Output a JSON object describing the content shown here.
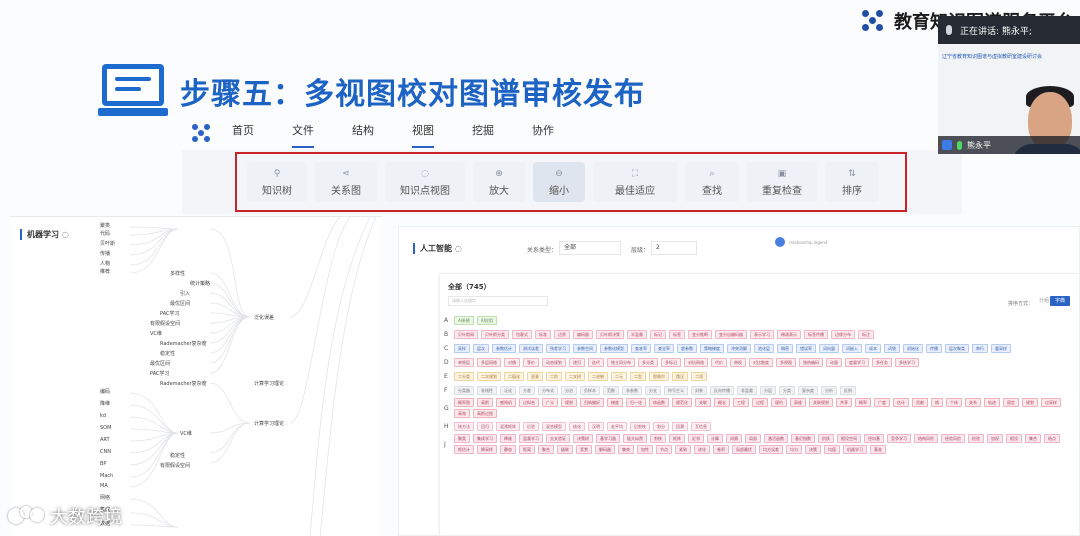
{
  "brand": {
    "text": "教育知识图谱服务平台"
  },
  "heading": {
    "title": "步骤五：多视图校对图谱审核发布"
  },
  "appnav": {
    "items": [
      {
        "label": "首页",
        "active": false
      },
      {
        "label": "文件",
        "active": true
      },
      {
        "label": "结构",
        "active": false
      },
      {
        "label": "视图",
        "active": true
      },
      {
        "label": "挖掘",
        "active": false
      },
      {
        "label": "协作",
        "active": false
      }
    ]
  },
  "toolbar": {
    "tools": [
      {
        "label": "知识树",
        "icon": "tree-icon",
        "glyph": "⚲",
        "selected": false
      },
      {
        "label": "关系图",
        "icon": "share-icon",
        "glyph": "⋖",
        "selected": false
      },
      {
        "label": "知识点视图",
        "icon": "bulb-icon",
        "glyph": "◌",
        "selected": false
      },
      {
        "label": "放大",
        "icon": "zoom-in-icon",
        "glyph": "⊕",
        "selected": false
      },
      {
        "label": "缩小",
        "icon": "zoom-out-icon",
        "glyph": "⊖",
        "selected": true
      },
      {
        "label": "最佳适应",
        "icon": "fit-icon",
        "glyph": "⛶",
        "selected": false
      },
      {
        "label": "查找",
        "icon": "search-icon",
        "glyph": "⌕",
        "selected": false
      },
      {
        "label": "重复检查",
        "icon": "check-icon",
        "glyph": "▣",
        "selected": false
      },
      {
        "label": "排序",
        "icon": "sort-icon",
        "glyph": "⇅",
        "selected": false
      }
    ]
  },
  "left_panel": {
    "title": "机器学习 ◌",
    "nodes": [
      "聚类",
      "代码",
      "贝叶斯",
      "传播",
      "人物",
      "推荐",
      "多样性",
      "统计策略",
      "引入",
      "最优区间",
      "PAC学习",
      "有限假设空间",
      "VC维",
      "Rademacher复杂度",
      "稳定性",
      "最优区间",
      "PAC学习",
      "Rademacher复杂度",
      "泛化误差",
      "计算学习理论",
      "编码",
      "降维",
      "kd",
      "SOM",
      "ART",
      "CNN",
      "BP",
      "Mach",
      "MA",
      "网络",
      "VC维",
      "计算学习理论",
      "稳定性",
      "有限假设空间",
      "集成",
      "数据"
    ]
  },
  "right_panel": {
    "title": "人工智能 ◌",
    "filter_label": "关系类型：",
    "filter_value": "全部",
    "level_label": "层级：",
    "level_value": "2",
    "dot_label": "relationship legend",
    "inner": {
      "title": "全部（745）",
      "search_placeholder": "请输入关键字",
      "sort_label": "排序方式：",
      "sort_off": "分组",
      "sort_on": "字典"
    },
    "rows": [
      {
        "letter": "A",
        "chips": [
          "AI系统",
          "AI应用"
        ]
      },
      {
        "letter": "B",
        "chips": [
          "贝叶斯网",
          "贝叶斯分类",
          "包裹式",
          "标准",
          "边界",
          "编码器",
          "贝叶斯决策",
          "半监督",
          "标记",
          "标签",
          "变分推断",
          "变分自编码器",
          "表示学习",
          "稀疏表示",
          "标签传播",
          "边缘分布",
          "标注"
        ]
      },
      {
        "letter": "C",
        "chips": [
          "采样",
          "层次",
          "参数估计",
          "测试误差",
          "残差学习",
          "参数空间",
          "参数化模型",
          "查准率",
          "查全率",
          "超参数",
          "策略梯度",
          "冲突消解",
          "池化层",
          "稠密",
          "错误率",
          "词向量",
          "词嵌入",
          "成本",
          "词袋",
          "初始化",
          "传播",
          "层次聚类",
          "串行",
          "重采样"
        ]
      },
      {
        "letter": "D",
        "chips": [
          "单隐层",
          "多层网络",
          "对偶",
          "等价",
          "动态规划",
          "递归",
          "迭代",
          "独立同分布",
          "多分类",
          "多标记",
          "对抗网络",
          "代价",
          "带权",
          "对比散度",
          "多视图",
          "独热编码",
          "动量",
          "度量学习",
          "多任务",
          "多核学习"
        ]
      },
      {
        "letter": "E",
        "chips": [
          "二分类",
          "二次规划",
          "二值化",
          "恶意",
          "二阶",
          "二叉树",
          "二进制",
          "二元",
          "二型",
          "恩格尔",
          "饿汉",
          "二项"
        ]
      },
      {
        "letter": "F",
        "chips": [
          "分类器",
          "非线性",
          "泛化",
          "方差",
          "分布式",
          "分治",
          "负样本",
          "范数",
          "非参数",
          "分支",
          "符号主义",
          "封装",
          "反向传播",
          "非监督",
          "分层",
          "分类",
          "复杂度",
          "分析",
          "反例"
        ]
      },
      {
        "letter": "G",
        "chips": [
          "概率图",
          "高斯",
          "感知机",
          "过拟合",
          "广义",
          "规则",
          "归纳偏好",
          "梯度",
          "归一化",
          "核函数",
          "规范化",
          "关联",
          "概念",
          "工程",
          "过程",
          "规约",
          "高维",
          "关联规则",
          "共享",
          "概率",
          "广度",
          "估计",
          "贡献",
          "格",
          "个体",
          "关系",
          "轨迹",
          "固定",
          "规划",
          "过采样",
          "高效",
          "高斯过程"
        ]
      },
      {
        "letter": "H",
        "chips": [
          "核方法",
          "回归",
          "混淆矩阵",
          "后验",
          "混合模型",
          "核化",
          "汉明",
          "宏平均",
          "后剪枝",
          "划分",
          "回溯",
          "互信息"
        ]
      },
      {
        "letter": "J",
        "chips": [
          "聚类",
          "集成学习",
          "降维",
          "监督学习",
          "交叉验证",
          "决策树",
          "基学习器",
          "极大似然",
          "剪枝",
          "矩阵",
          "近邻",
          "计算",
          "间隔",
          "局部",
          "激活函数",
          "基尼指数",
          "阶跃",
          "假设空间",
          "径向基",
          "竞争学习",
          "结构风险",
          "经验风险",
          "检验",
          "加权",
          "假设",
          "集合",
          "结点",
          "矩估计",
          "降采样",
          "静态",
          "距离",
          "聚合",
          "级联",
          "奖赏",
          "解码器",
          "集束",
          "加性",
          "节点",
          "紧致",
          "进化",
          "卷积",
          "局部最优",
          "均方误差",
          "均匀",
          "决策",
          "均值",
          "机器学习",
          "基准"
        ]
      }
    ]
  },
  "video": {
    "speaking": "正在讲话: 熊永平;",
    "banner": "辽宁省教育知识图谱与虚拟教研室建设研讨会",
    "name": "熊永平"
  },
  "watermark": {
    "text": "大数跨境"
  },
  "colors": {
    "accent": "#2b62c6",
    "heading": "#1d63c4",
    "highlight_border": "#c8242a",
    "chip_palette": [
      {
        "bg": "#eaf6e6",
        "border": "#bfe0b0",
        "text": "#5a8f47"
      },
      {
        "bg": "#fde9ee",
        "border": "#f3b8c5",
        "text": "#b34660"
      },
      {
        "bg": "#e8effc",
        "border": "#b8cbef",
        "text": "#3e63a8"
      },
      {
        "bg": "#fdecef",
        "border": "#f2b4c0",
        "text": "#a8455a"
      },
      {
        "bg": "#fdf3e1",
        "border": "#f0d5a0",
        "text": "#a87722"
      },
      {
        "bg": "#f1f2f4",
        "border": "#dcdfe4",
        "text": "#777777"
      },
      {
        "bg": "#fde8ec",
        "border": "#f0b0bc",
        "text": "#b04058"
      },
      {
        "bg": "#fdeff3",
        "border": "#f4c2cf",
        "text": "#a94c63"
      },
      {
        "bg": "#fbe7ee",
        "border": "#efb4c6",
        "text": "#a5405e"
      }
    ]
  }
}
